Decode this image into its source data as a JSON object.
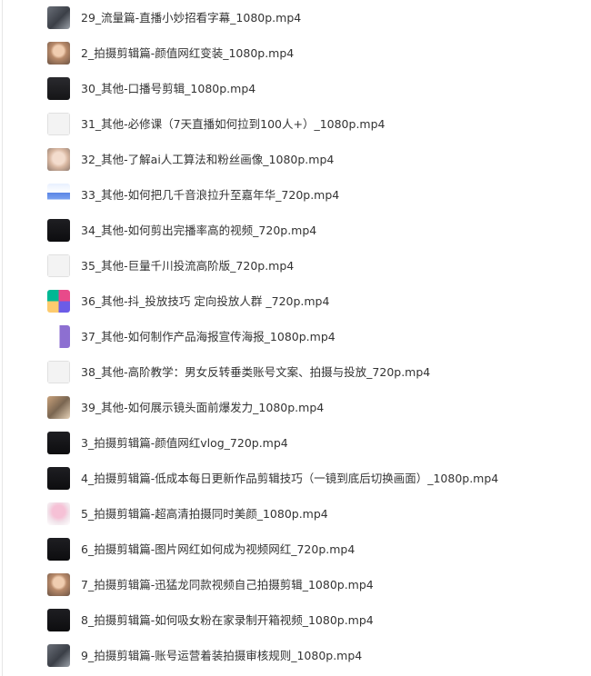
{
  "files": [
    {
      "name": "29_流量篇-直播小妙招看字幕_1080p.mp4",
      "thumb": "dark-gray"
    },
    {
      "name": "2_拍摄剪辑篇-颜值网红变装_1080p.mp4",
      "thumb": "portrait-warm"
    },
    {
      "name": "30_其他-口播号剪辑_1080p.mp4",
      "thumb": "dark"
    },
    {
      "name": "31_其他-必修课（7天直播如何拉到100人+）_1080p.mp4",
      "thumb": "light-doc"
    },
    {
      "name": "32_其他-了解ai人工算法和粉丝画像_1080p.mp4",
      "thumb": "portrait-light"
    },
    {
      "name": "33_其他-如何把几千音浪拉升至嘉年华_720p.mp4",
      "thumb": "blue-doc"
    },
    {
      "name": "34_其他-如何剪出完播率高的视频_720p.mp4",
      "thumb": "dark-video"
    },
    {
      "name": "35_其他-巨量千川投流高阶版_720p.mp4",
      "thumb": "light-doc"
    },
    {
      "name": "36_其他-抖_投放技巧 定向投放人群 _720p.mp4",
      "thumb": "colorful-grid"
    },
    {
      "name": "37_其他-如何制作产品海报宣传海报_1080p.mp4",
      "thumb": "purple-doc"
    },
    {
      "name": "38_其他-高阶教学：男女反转垂类账号文案、拍摄与投放_720p.mp4",
      "thumb": "light-doc"
    },
    {
      "name": "39_其他-如何展示镜头面前爆发力_1080p.mp4",
      "thumb": "photo-warm"
    },
    {
      "name": "3_拍摄剪辑篇-颜值网红vlog_720p.mp4",
      "thumb": "dark-video"
    },
    {
      "name": "4_拍摄剪辑篇-低成本每日更新作品剪辑技巧（一镜到底后切换画面）_1080p.mp4",
      "thumb": "dark-video"
    },
    {
      "name": "5_拍摄剪辑篇-超高清拍摄同时美颜_1080p.mp4",
      "thumb": "pink-light"
    },
    {
      "name": "6_拍摄剪辑篇-图片网红如何成为视频网红_720p.mp4",
      "thumb": "dark-video"
    },
    {
      "name": "7_拍摄剪辑篇-迅猛龙同款视频自己拍摄剪辑_1080p.mp4",
      "thumb": "portrait-warm"
    },
    {
      "name": "8_拍摄剪辑篇-如何吸女粉在家录制开箱视频_1080p.mp4",
      "thumb": "dark-video"
    },
    {
      "name": "9_拍摄剪辑篇-账号运营着装拍摄审核规则_1080p.mp4",
      "thumb": "dark-gray"
    }
  ],
  "colors": {
    "text": "#333333",
    "background": "#ffffff"
  }
}
